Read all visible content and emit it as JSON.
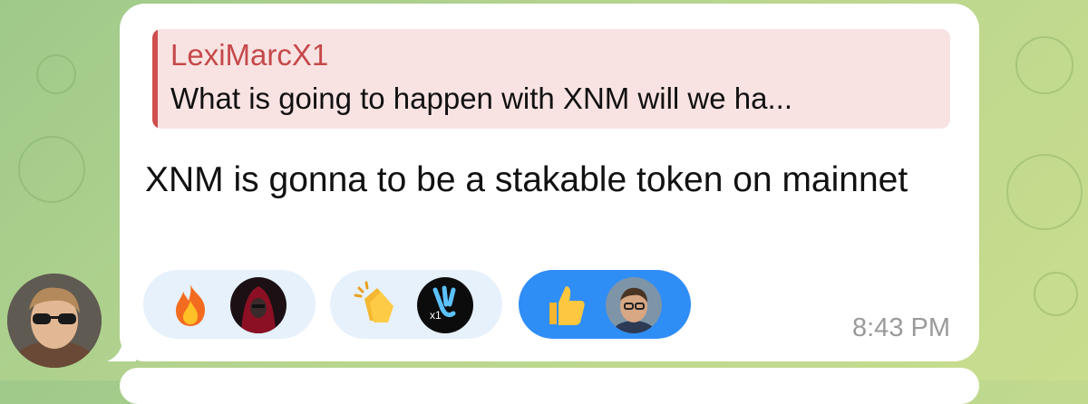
{
  "reply": {
    "author": "LexiMarcX1",
    "preview": "What is going to happen with XNM will we ha..."
  },
  "message": {
    "text": "XNM is gonna to be a stakable token on mainnet",
    "time": "8:43 PM"
  },
  "reactions": [
    {
      "emoji": "fire-emoji",
      "avatar": "hooded-figure-avatar",
      "selected": false
    },
    {
      "emoji": "clapping-hands-emoji",
      "avatar": "x1-logo-avatar",
      "selected": false
    },
    {
      "emoji": "thumbs-up-emoji",
      "avatar": "smiling-man-avatar",
      "selected": true
    }
  ],
  "colors": {
    "accent": "#2f8df6",
    "reply_bar": "#cf4f4e",
    "reply_name": "#c6484b",
    "reaction_bg": "#e6f1fc"
  }
}
